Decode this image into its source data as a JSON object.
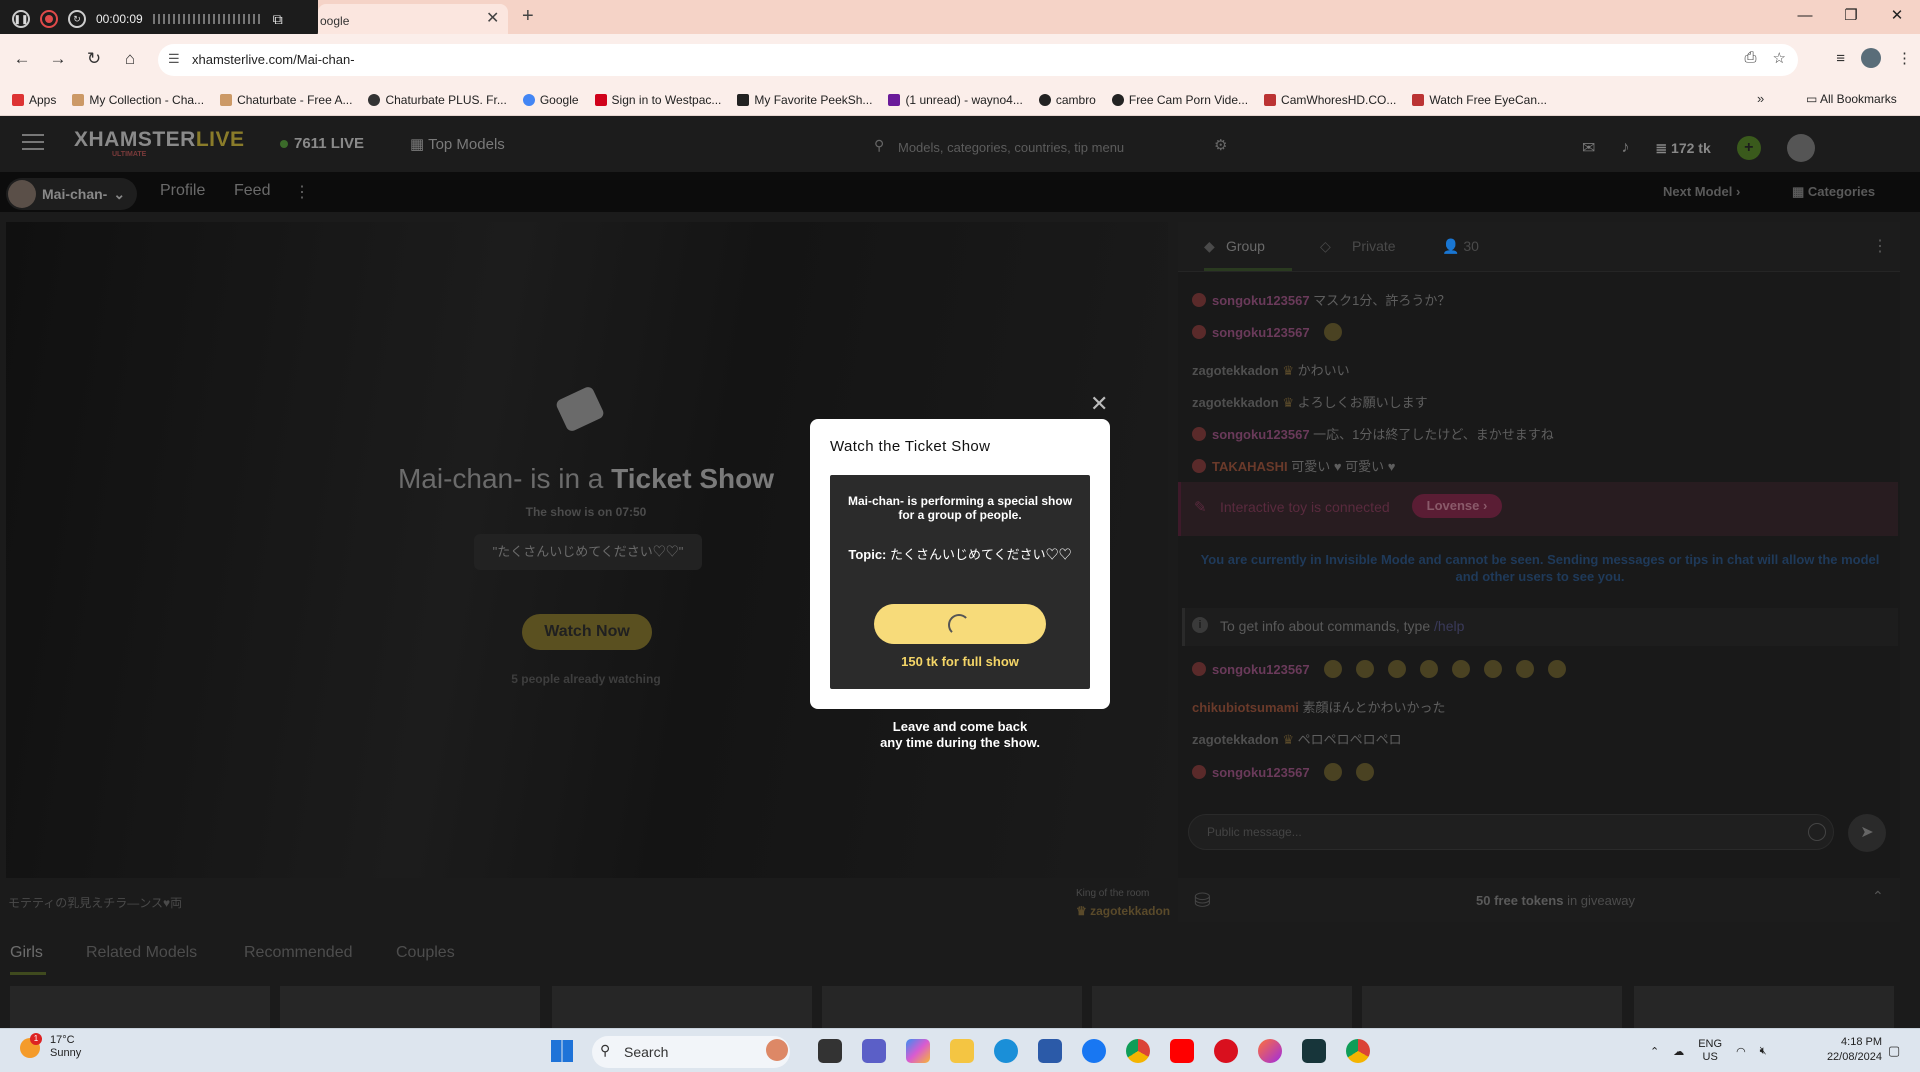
{
  "recorder": {
    "time": "00:00:09"
  },
  "browser": {
    "tab_title": "oogle",
    "url": "xhamsterlive.com/Mai-chan-",
    "bookmarks": [
      "Apps",
      "My Collection - Cha...",
      "Chaturbate - Free A...",
      "Chaturbate PLUS. Fr...",
      "Google",
      "Sign in to Westpac...",
      "My Favorite PeekSh...",
      "(1 unread) - wayno4...",
      "cambro",
      "Free Cam Porn Vide...",
      "CamWhoresHD.CO...",
      "Watch Free EyeCan..."
    ],
    "all_bookmarks": "All Bookmarks"
  },
  "site": {
    "logo": "XHAMSTER",
    "logo_live": "LIVE",
    "logo_sub": "ULTIMATE",
    "live_count": "7611 LIVE",
    "top_models": "Top Models",
    "search_placeholder": "Models, categories, countries, tip menu",
    "tokens": "172 tk",
    "model_name": "Mai-chan-",
    "nav_profile": "Profile",
    "nav_feed": "Feed",
    "next_model": "Next Model",
    "categories": "Categories"
  },
  "player": {
    "title_prefix": "Mai-chan- is in a",
    "title_bold": "Ticket Show",
    "show_time": "The show is on 07:50",
    "topic": "\"たくさんいじめてください♡♡\"",
    "watch_now": "Watch Now",
    "watching": "5 people already watching",
    "caption": "モテティの乳見えチラ―ンス♥両",
    "king_label": "King of the room",
    "king_name": "zagotekkadon"
  },
  "bottom_tabs": [
    "Girls",
    "Related Models",
    "Recommended",
    "Couples"
  ],
  "chat": {
    "tab_group": "Group",
    "tab_private": "Private",
    "viewers": "30",
    "messages_top": [
      {
        "user": "songoku123567",
        "text": "マスク1分、許ろうか？",
        "style": "red"
      },
      {
        "user": "songoku123567",
        "text": "",
        "style": "red"
      },
      {
        "user": "zagotekkadon",
        "text": "かわいい",
        "style": "gray"
      },
      {
        "user": "zagotekkadon",
        "text": "よろしくお願いします",
        "style": "gray"
      },
      {
        "user": "songoku123567",
        "text": "一応、1分は終了したけど、まかせますね",
        "style": "red"
      },
      {
        "user": "TAKAHASHI",
        "text": "可愛い ♥ 可愛い ♥",
        "style": "orange"
      }
    ],
    "lovense_text": "Interactive toy is connected",
    "lovense_btn": "Lovense",
    "invisible_note": "You are currently in Invisible Mode and cannot be seen. Sending messages or tips in chat will allow the model and other users to see you.",
    "help_prefix": "To get info about commands, type",
    "help_cmd": "/help",
    "messages_bottom": [
      {
        "user": "songoku123567",
        "text": "",
        "style": "red"
      },
      {
        "user": "chikubiotsumami",
        "text": "素顔ほんとかわいかった",
        "style": "orange"
      },
      {
        "user": "zagotekkadon",
        "text": "ペロペロペロペロ",
        "style": "gray"
      },
      {
        "user": "songoku123567",
        "text": "",
        "style": "red"
      }
    ],
    "input_placeholder": "Public message...",
    "giveaway_bold": "50 free tokens",
    "giveaway_rest": "in giveaway"
  },
  "modal": {
    "title": "Watch the Ticket Show",
    "desc_name": "Mai-chan-",
    "desc_rest": "is performing a special show for a group of people.",
    "topic_label": "Topic:",
    "topic_value": "たくさんいじめてください♡♡",
    "price": "150 tk for full show",
    "leave_line1": "Leave and come back",
    "leave_line2": "any time during the show."
  },
  "taskbar": {
    "temp": "17°C",
    "weather": "Sunny",
    "weather_badge": "1",
    "search": "Search",
    "lang1": "ENG",
    "lang2": "US",
    "time": "4:18 PM",
    "date": "22/08/2024"
  }
}
